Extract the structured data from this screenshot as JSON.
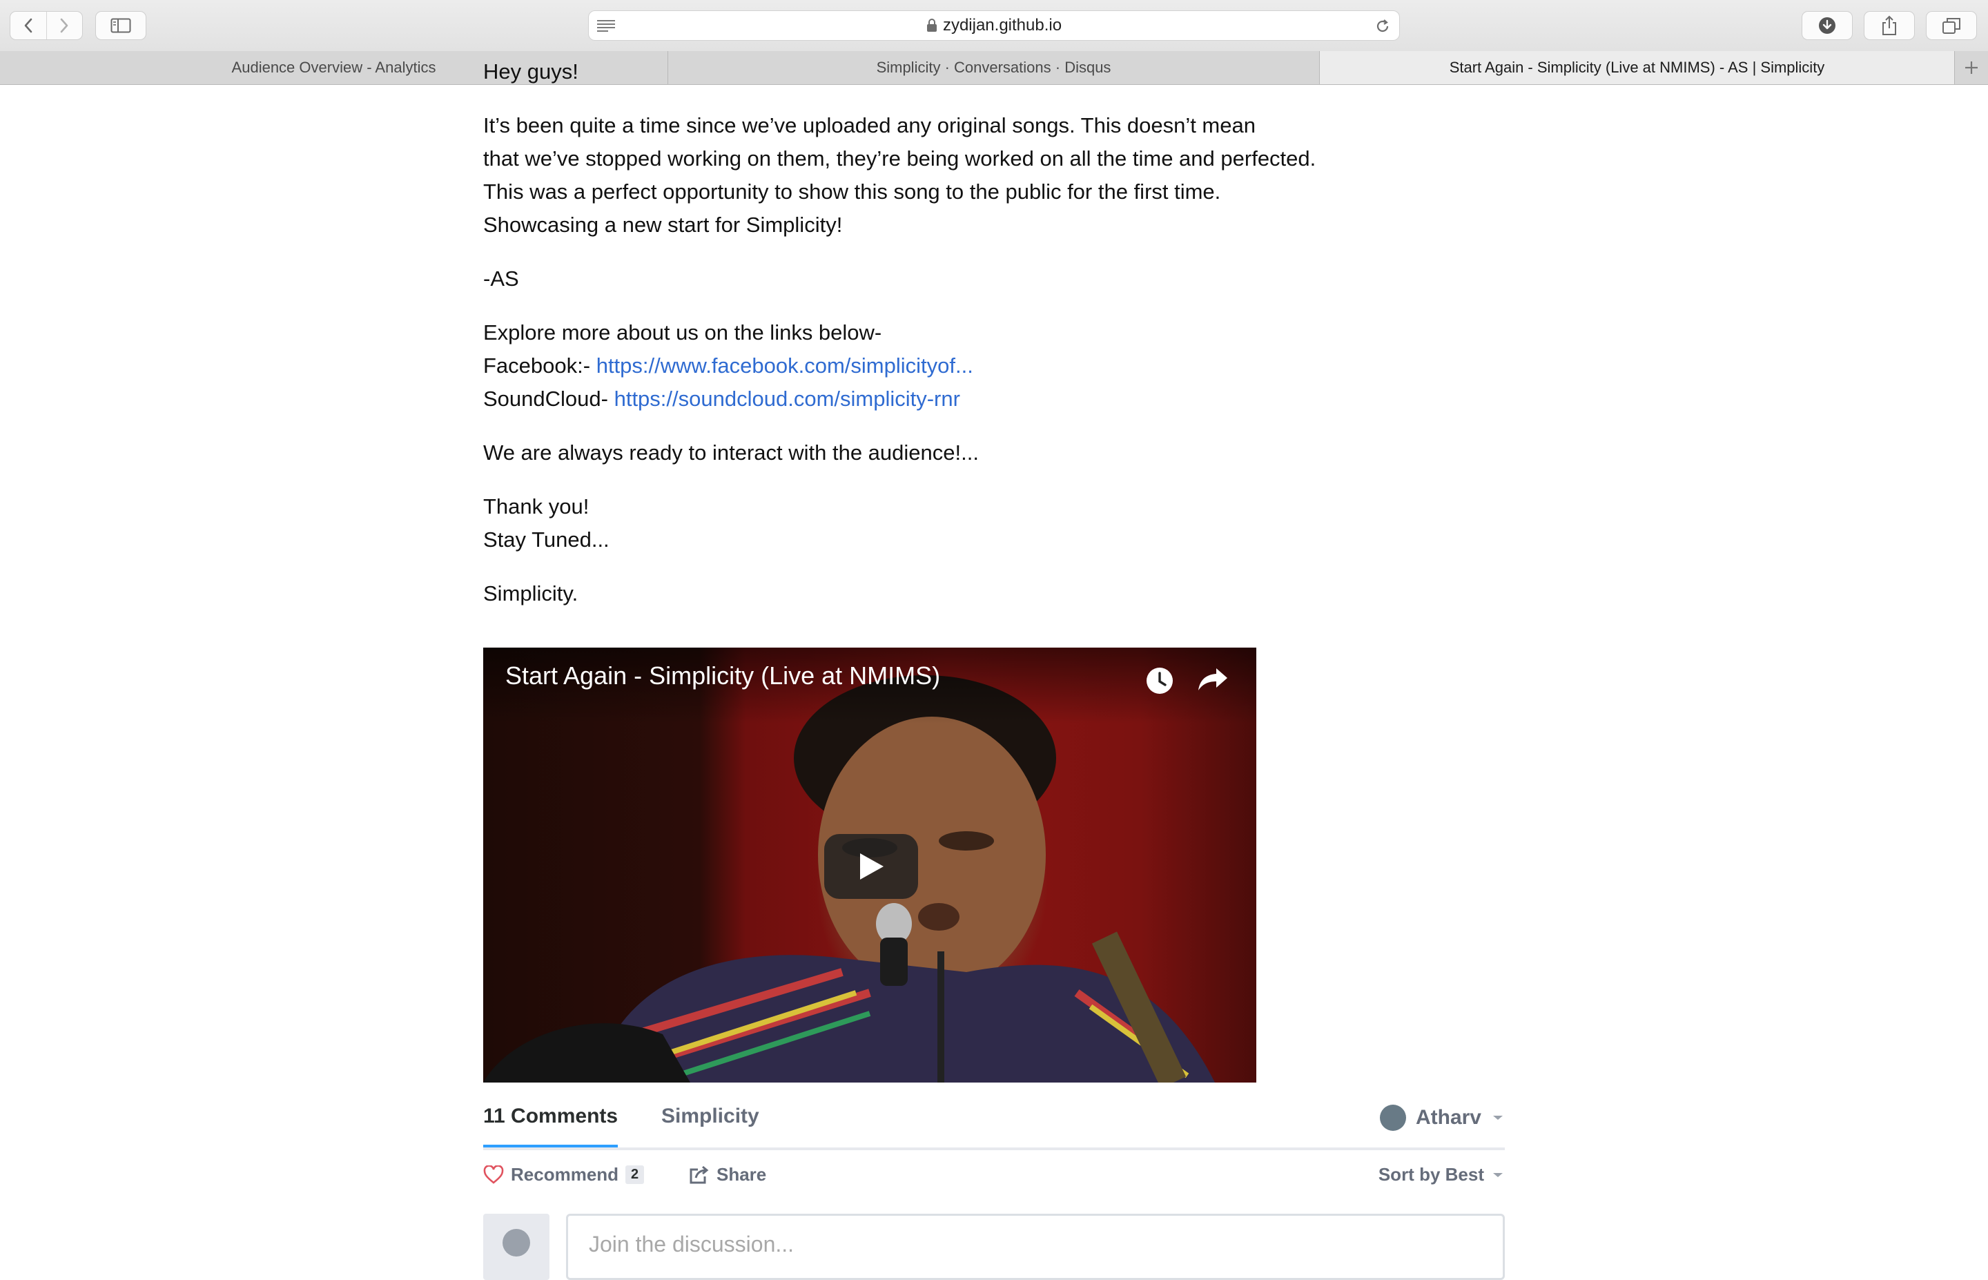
{
  "browser": {
    "url": "zydijan.github.io",
    "tabs": [
      {
        "label": "Audience Overview - Analytics",
        "active": false
      },
      {
        "label": "Simplicity · Conversations · Disqus",
        "active": false
      },
      {
        "label": "Start Again - Simplicity (Live at NMIMS) - AS | Simplicity",
        "active": true
      }
    ]
  },
  "article": {
    "greeting": "Hey guys!",
    "intro": [
      "It’s been quite a time since we’ve uploaded any original songs. This doesn’t mean",
      "that we’ve stopped working on them, they’re being worked on all the time and perfected.",
      "This was a perfect opportunity to show this song to the public for the first time.",
      "Showcasing a new start for Simplicity!"
    ],
    "signature": "-AS",
    "links_intro": "Explore more about us on the links below-",
    "facebook_label": "Facebook:-",
    "facebook_url": "https://www.facebook.com/simplicityof...",
    "soundcloud_label": "SoundCloud-",
    "soundcloud_url": "https://soundcloud.com/simplicity-rnr",
    "interact": "We are always ready to interact with the audience!...",
    "thanks": "Thank you!",
    "stay_tuned": "Stay Tuned...",
    "closing": "Simplicity."
  },
  "video": {
    "title": "Start Again - Simplicity (Live at NMIMS)",
    "icons": [
      "watch-later-icon",
      "share-icon",
      "play-icon"
    ]
  },
  "disqus": {
    "comments_tab": "11 Comments",
    "community_tab": "Simplicity",
    "user": "Atharv",
    "recommend_label": "Recommend",
    "recommend_count": "2",
    "share_label": "Share",
    "sort_label": "Sort by Best",
    "input_placeholder": "Join the discussion...",
    "accent": "#2e9fff",
    "link_color": "#2f6bd1"
  }
}
